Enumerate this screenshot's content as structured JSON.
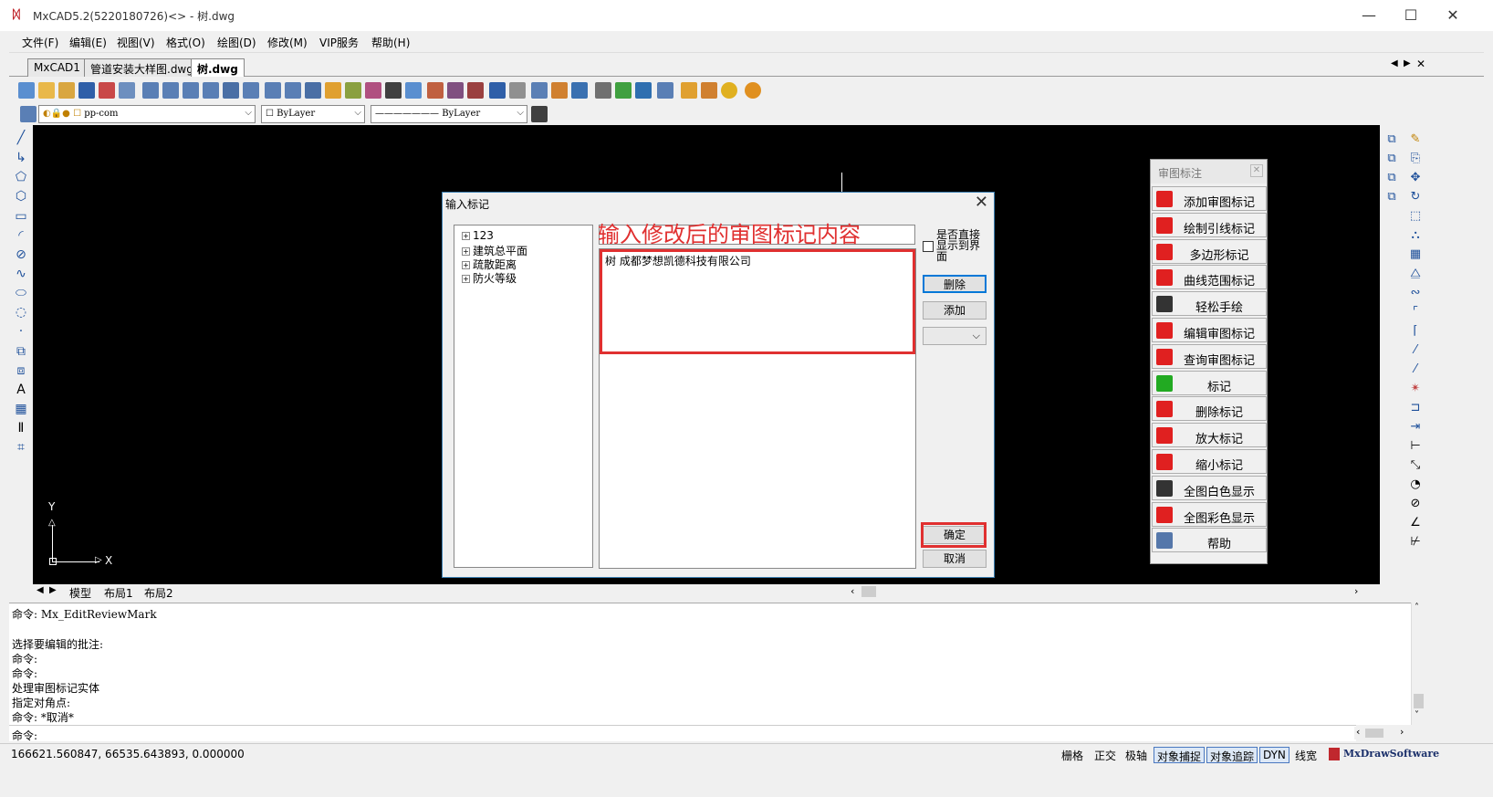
{
  "window": {
    "title": "MxCAD5.2(5220180726)<> - 树.dwg",
    "minimize": "—",
    "maximize": "☐",
    "close": "✕"
  },
  "menu": [
    "文件(F)",
    "编辑(E)",
    "视图(V)",
    "格式(O)",
    "绘图(D)",
    "修改(M)",
    "VIP服务",
    "帮助(H)"
  ],
  "doc_tabs": [
    "MxCAD1",
    "管道安装大样图.dwg",
    "树.dwg"
  ],
  "tab_nav": [
    "◀",
    "▶",
    "✕"
  ],
  "toolbar2": {
    "layer": "pp-com",
    "color": "ByLayer",
    "linetype": "ByLayer"
  },
  "dialog": {
    "title": "输入标记",
    "close": "✕",
    "tree_items": [
      "123",
      "建筑总平面",
      "疏散距离",
      "防火等级"
    ],
    "overlay_hint": "输入修改后的审图标记内容",
    "text_content": "树 成都梦想凯德科技有限公司",
    "checkbox_label": "是否直接显示到界面",
    "delete_button": "删除",
    "add_button": "添加",
    "ok_button": "确定",
    "cancel_button": "取消"
  },
  "review_panel": {
    "title": "审图标注",
    "close": "✕",
    "buttons": [
      {
        "label": "添加审图标记",
        "icon": "add-mark-icon",
        "color": "#e02020"
      },
      {
        "label": "绘制引线标记",
        "icon": "leader-mark-icon",
        "color": "#e02020"
      },
      {
        "label": "多边形标记",
        "icon": "polygon-mark-icon",
        "color": "#e02020"
      },
      {
        "label": "曲线范围标记",
        "icon": "curve-mark-icon",
        "color": "#e02020"
      },
      {
        "label": "轻松手绘",
        "icon": "pen-icon",
        "color": "#333333"
      },
      {
        "label": "编辑审图标记",
        "icon": "edit-mark-icon",
        "color": "#e02020"
      },
      {
        "label": "查询审图标记",
        "icon": "query-mark-icon",
        "color": "#e02020"
      },
      {
        "label": "标记",
        "icon": "check-mark-icon",
        "color": "#22aa22"
      },
      {
        "label": "删除标记",
        "icon": "delete-mark-icon",
        "color": "#e02020"
      },
      {
        "label": "放大标记",
        "icon": "zoom-in-mark-icon",
        "color": "#e02020"
      },
      {
        "label": "缩小标记",
        "icon": "zoom-out-mark-icon",
        "color": "#e02020"
      },
      {
        "label": "全图白色显示",
        "icon": "white-display-icon",
        "color": "#333333"
      },
      {
        "label": "全图彩色显示",
        "icon": "color-display-icon",
        "color": "#e02020"
      },
      {
        "label": "帮助",
        "icon": "help-icon",
        "color": "#5577aa"
      }
    ]
  },
  "layout_tabs": [
    "模型",
    "布局1",
    "布局2"
  ],
  "ucs": {
    "x_label": "X",
    "y_label": "Y"
  },
  "command_history": [
    "命令: Mx_EditReviewMark",
    "",
    "选择要编辑的批注:",
    "命令:",
    "命令:",
    " 处理审图标记实体",
    " 指定对角点:",
    "命令:  *取消*"
  ],
  "command_prompt": "命令:",
  "status": {
    "coords": "166621.560847,  66535.643893,  0.000000",
    "toggles": [
      {
        "label": "栅格",
        "on": false
      },
      {
        "label": "正交",
        "on": false
      },
      {
        "label": "极轴",
        "on": false
      },
      {
        "label": "对象捕捉",
        "on": true
      },
      {
        "label": "对象追踪",
        "on": true
      },
      {
        "label": "DYN",
        "on": true
      },
      {
        "label": "线宽",
        "on": false
      }
    ],
    "brand": "MxDrawSoftware"
  },
  "colors": {
    "canvas": "#000000",
    "highlight_red": "#e03030",
    "accent_blue": "#0078d7"
  }
}
